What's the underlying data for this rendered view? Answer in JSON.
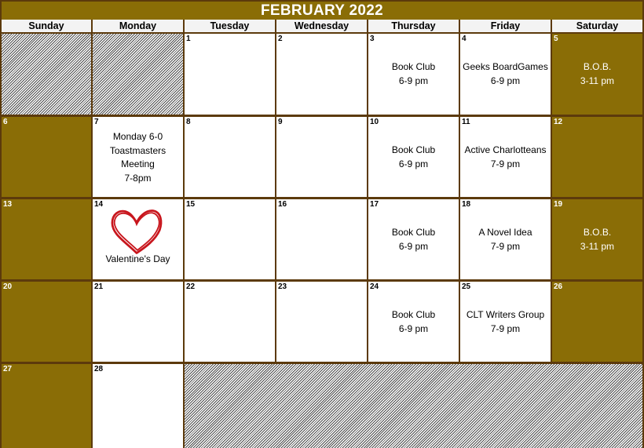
{
  "title": "FEBRUARY 2022",
  "days": [
    "Sunday",
    "Monday",
    "Tuesday",
    "Wednesday",
    "Thursday",
    "Friday",
    "Saturday"
  ],
  "colors": {
    "brand": "#8a6d06",
    "border": "#5c3a0c",
    "heart": "#c8161d"
  },
  "weeks": [
    [
      {
        "blank": true
      },
      {
        "blank": true
      },
      {
        "num": "1",
        "events": []
      },
      {
        "num": "2",
        "events": []
      },
      {
        "num": "3",
        "events": [
          "Book Club",
          "6-9 pm"
        ]
      },
      {
        "num": "4",
        "events": [
          "Geeks BoardGames",
          "6-9 pm"
        ]
      },
      {
        "num": "5",
        "weekend": true,
        "events": [
          "B.O.B.",
          "3-11 pm"
        ]
      }
    ],
    [
      {
        "num": "6",
        "weekend": true,
        "events": []
      },
      {
        "num": "7",
        "events": [
          "Monday 6-0",
          "Toastmasters",
          "Meeting",
          "7-8pm"
        ]
      },
      {
        "num": "8",
        "events": []
      },
      {
        "num": "9",
        "events": []
      },
      {
        "num": "10",
        "events": [
          "Book Club",
          "6-9 pm"
        ]
      },
      {
        "num": "11",
        "events": [
          "Active Charlotteans",
          "7-9 pm"
        ]
      },
      {
        "num": "12",
        "weekend": true,
        "events": []
      }
    ],
    [
      {
        "num": "13",
        "weekend": true,
        "events": []
      },
      {
        "num": "14",
        "heart": "heart-icon",
        "events": [
          "Valentine's Day"
        ]
      },
      {
        "num": "15",
        "events": []
      },
      {
        "num": "16",
        "events": []
      },
      {
        "num": "17",
        "events": [
          "Book Club",
          "6-9 pm"
        ]
      },
      {
        "num": "18",
        "events": [
          "A Novel Idea",
          "7-9 pm"
        ]
      },
      {
        "num": "19",
        "weekend": true,
        "events": [
          "B.O.B.",
          "3-11 pm"
        ]
      }
    ],
    [
      {
        "num": "20",
        "weekend": true,
        "events": []
      },
      {
        "num": "21",
        "events": []
      },
      {
        "num": "22",
        "events": []
      },
      {
        "num": "23",
        "events": []
      },
      {
        "num": "24",
        "events": [
          "Book Club",
          "6-9 pm"
        ]
      },
      {
        "num": "25",
        "events": [
          "CLT Writers Group",
          "7-9 pm"
        ]
      },
      {
        "num": "26",
        "weekend": true,
        "events": []
      }
    ],
    [
      {
        "num": "27",
        "weekend": true,
        "events": []
      },
      {
        "num": "28",
        "events": []
      },
      {
        "blank": true,
        "span": 5
      }
    ]
  ]
}
